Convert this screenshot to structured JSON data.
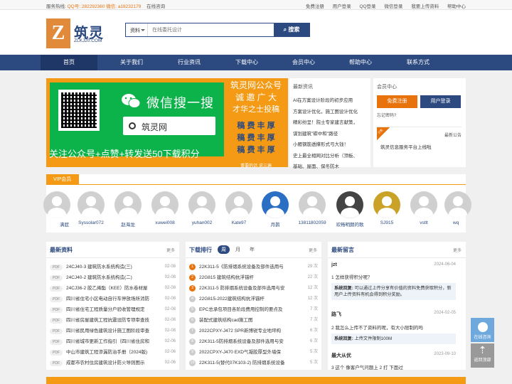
{
  "topbar": {
    "hotline_label": "服务热线:",
    "qq": "QQ号: 282292360",
    "wechat": "微信: a18232179",
    "online": "在线咨询",
    "links": [
      "免费注册",
      "用户登录",
      "QQ登录",
      "微信登录",
      "我要上传资料",
      "帮助中心"
    ]
  },
  "logo": {
    "mark": "Z",
    "cn": "筑灵",
    "en": "ZLKJ20.COM"
  },
  "search": {
    "category": "资料",
    "placeholder": "在线委托设计",
    "button": "搜索"
  },
  "nav": [
    "首页",
    "关于我们",
    "行业资讯",
    "下载中心",
    "会员中心",
    "帮助中心",
    "联系方式"
  ],
  "banner": {
    "wx_title": "微信搜一搜",
    "wx_search": "筑灵网",
    "footer": "关注公众号+点赞+转发送50下载积分",
    "right_lines": [
      "筑灵网公众号",
      "诚 邀 广 大",
      "才华之士投稿"
    ],
    "right_gold": [
      "稿 费 丰 厚",
      "稿 费 丰 厚",
      "稿 费 丰 厚"
    ],
    "right_small": "重要的话 说三遍"
  },
  "news": {
    "title": "最新资讯",
    "items": [
      "AI在方案设计阶段的初步应用",
      "方案设计优化，施工图设计优化",
      "精彩纷呈！院士专家建言献策，",
      "谋划建筑\"碳中和\"路径",
      "小雁钢筋透撑形式弓大钱！",
      "史上最全相网对比分析（顶板、",
      "基础、屋面、保冬防木"
    ]
  },
  "member": {
    "title": "会员中心",
    "register": "免费注册",
    "login": "用户登录",
    "forgot": "忘记密码?",
    "notice_tag": "公告",
    "notice_label": "最新公告",
    "notice_text": "筑灵信息服务平台上线啦"
  },
  "vip": {
    "title": "VIP会员",
    "users": [
      "满屁",
      "Syssolar072",
      "赵海龙",
      "xuwei008",
      "yuhan002",
      "Kate97",
      "月鹊",
      "13811802059",
      "欢畅明朗的歌",
      "SJ915",
      "vstlt",
      "wq"
    ]
  },
  "latest": {
    "title": "最新资料",
    "more": "更多",
    "items": [
      {
        "t": "24CJ40-3 建筑防水系统构造(三)",
        "d": "02-08"
      },
      {
        "t": "24CJ40-2 建筑防水系统构造(二)",
        "d": "02-08"
      },
      {
        "t": "24CJ36-2 胶乙烯酯（KEE）防水卷材屋",
        "d": "02-08"
      },
      {
        "t": "四川省住宅小区电动自行车停放场所消防",
        "d": "02-08"
      },
      {
        "t": "四川省住宅工程质量分户验收管理规定",
        "d": "02-08"
      },
      {
        "t": "四川省房屋建筑工程抗震设防专项审查技",
        "d": "02-08"
      },
      {
        "t": "四川省民用绿色建筑设计施工图阶段审查",
        "d": "02-08"
      },
      {
        "t": "四川省城市更新工作指引（四川省住房和",
        "d": "02-06"
      },
      {
        "t": "中山市建筑工程渗漏防治手册（2024版)",
        "d": "02-06"
      },
      {
        "t": "成都市农村住房建筑设计防火导则图示",
        "d": "02-06"
      }
    ]
  },
  "rank": {
    "title": "下载排行",
    "tabs": [
      "周",
      "月",
      "年"
    ],
    "more": "更多",
    "items": [
      {
        "t": "22K311-5《防排烟系统设备及部件选用与",
        "c": "29 次"
      },
      {
        "t": "22G815 建筑结构抗浮锚杆",
        "c": "22 次"
      },
      {
        "t": "22K311-5 防排烟系统设备及部件选用与安",
        "c": "12 次"
      },
      {
        "t": "22G815-2022建筑结构抗浮锚杆",
        "c": "12 次"
      },
      {
        "t": "EPC总承包项目各阶段费用控制的要点及",
        "c": "7 次"
      },
      {
        "t": "装配式建筑结构cad施工图",
        "c": "7 次"
      },
      {
        "t": "2022CPXY-J472 SPR新博锐专业地坪构",
        "c": "6 次"
      },
      {
        "t": "22K311-5防排烟系统设备及部件选用与安",
        "c": "6 次"
      },
      {
        "t": "2022CPXY-J470 EXD气凝胶厚型外墙保",
        "c": "5 次"
      },
      {
        "t": "22K311-5(替代07K103-2) 防排烟系统设备",
        "c": "5 次"
      }
    ]
  },
  "messages": {
    "title": "最新留言",
    "more": "更多",
    "items": [
      {
        "user": "jzt",
        "date": "2024-06-04",
        "q": "1 怎样获得积分呢？",
        "a_label": "系统回复:",
        "a": "可以通过上传分享有价值的资料免费获取积分，新用户上传资料有机会得到积分奖励。"
      },
      {
        "user": "路飞",
        "date": "2024-02-05",
        "q": "2 我怎么上传不了资料的呢，有大小限制的吗",
        "a_label": "系统回复:",
        "a": "上传文件限制100M"
      },
      {
        "user": "最大从优",
        "date": "2023-09-10",
        "q": "3 这个 像客户气问题上 2 打 下面过",
        "a_label": "",
        "a": ""
      }
    ]
  },
  "side": {
    "consult": "在线咨询",
    "top": "返回顶部"
  }
}
